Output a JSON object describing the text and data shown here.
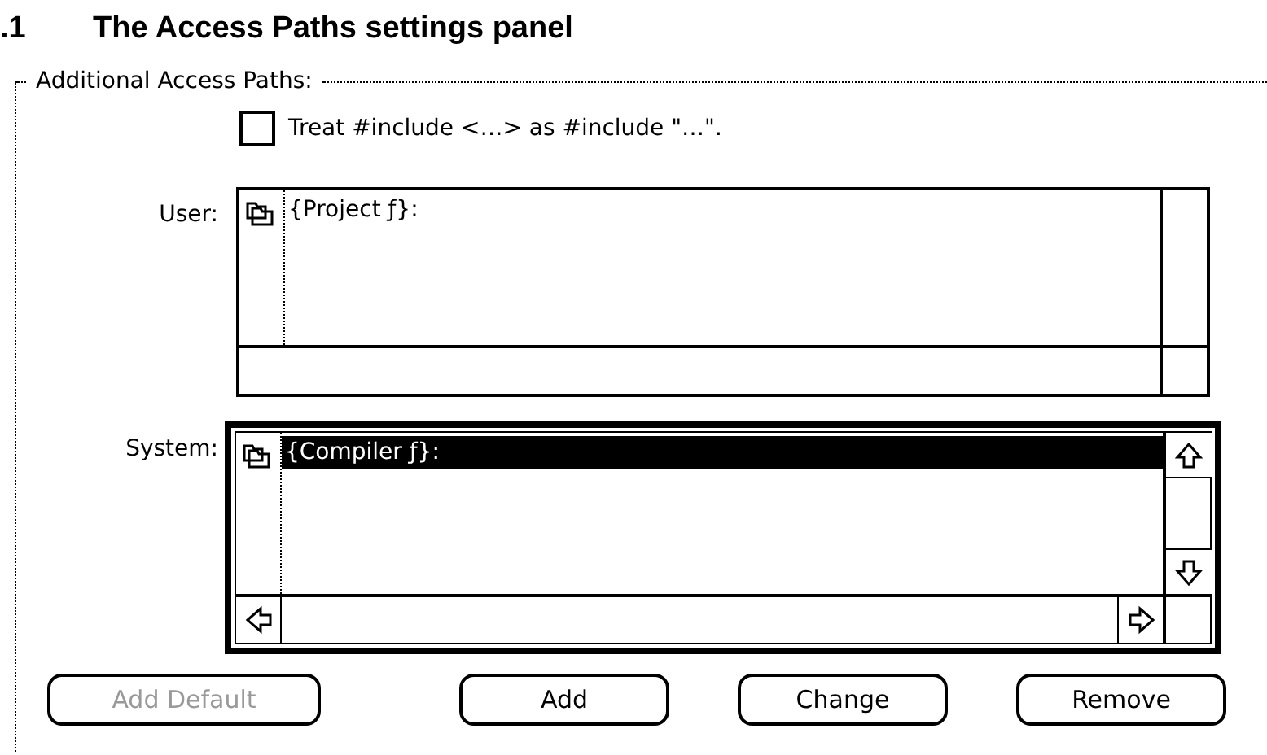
{
  "heading": {
    "number": ".1",
    "title": "The Access Paths settings panel"
  },
  "group": {
    "label": "Additional Access Paths:"
  },
  "treat_checkbox": {
    "label": "Treat #include <…> as #include \"…\".",
    "checked": false
  },
  "path_lists": [
    {
      "label": "User:",
      "active": false,
      "items": [
        {
          "text": "{Project ƒ}:",
          "selected": false
        }
      ]
    },
    {
      "label": "System:",
      "active": true,
      "items": [
        {
          "text": "{Compiler ƒ}:",
          "selected": true
        }
      ]
    }
  ],
  "buttons": [
    {
      "label": "Add Default",
      "disabled": true
    },
    {
      "label": "Add",
      "disabled": false
    },
    {
      "label": "Change",
      "disabled": false
    },
    {
      "label": "Remove",
      "disabled": false
    }
  ]
}
